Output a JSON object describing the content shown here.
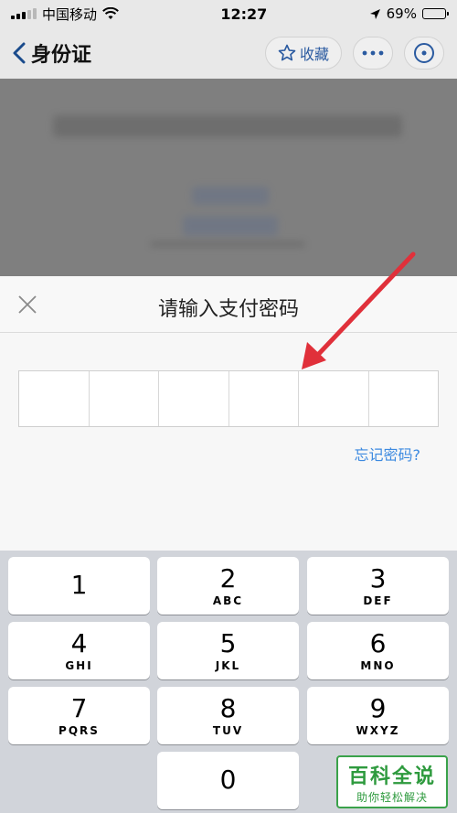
{
  "status_bar": {
    "carrier": "中国移动",
    "time": "12:27",
    "battery_percent": "69%",
    "battery_level": 0.69,
    "icons": [
      "signal-icon",
      "wifi-icon",
      "location-icon",
      "battery-icon"
    ]
  },
  "nav": {
    "title": "身份证",
    "favorite_label": "收藏",
    "icons": [
      "back-chevron-icon",
      "star-icon",
      "more-icon",
      "close-circle-icon"
    ]
  },
  "sheet": {
    "title": "请输入支付密码",
    "forgot_label": "忘记密码?",
    "digit_count": 6,
    "icons": [
      "close-x-icon"
    ]
  },
  "keypad": {
    "keys": [
      {
        "digit": "1",
        "letters": ""
      },
      {
        "digit": "2",
        "letters": "ABC"
      },
      {
        "digit": "3",
        "letters": "DEF"
      },
      {
        "digit": "4",
        "letters": "GHI"
      },
      {
        "digit": "5",
        "letters": "JKL"
      },
      {
        "digit": "6",
        "letters": "MNO"
      },
      {
        "digit": "7",
        "letters": "PQRS"
      },
      {
        "digit": "8",
        "letters": "TUV"
      },
      {
        "digit": "9",
        "letters": "WXYZ"
      },
      {
        "digit": "0",
        "letters": ""
      }
    ]
  },
  "watermark": {
    "main": "百科全说",
    "sub": "助你轻松解决"
  },
  "colors": {
    "accent_blue": "#3d8ae0",
    "annotation_red": "#e0303a",
    "watermark_green": "#2e9a3e"
  }
}
